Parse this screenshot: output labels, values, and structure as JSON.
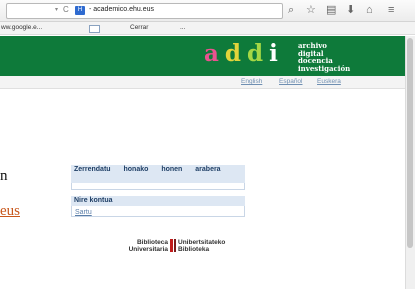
{
  "browser": {
    "dropdown_glyph": "▾",
    "reload_glyph": "C",
    "favicon_text": "H",
    "url_text": "- academico.ehu.eus",
    "icons": {
      "search": "⌕",
      "star": "☆",
      "bookmarks": "▤",
      "download": "⬇",
      "home": "⌂",
      "menu": "≡"
    }
  },
  "bookmarks_bar": {
    "item1": "ww.google.e...",
    "item2": "Cerrar",
    "item3": "..."
  },
  "header": {
    "logo_letters": [
      "a",
      "d",
      "d",
      "i"
    ],
    "logo_colors": [
      "#e9528f",
      "#e2d43b",
      "#a6d845",
      "#ffffff"
    ],
    "tagline": [
      "archivo",
      "digital",
      "docencia",
      "investigación"
    ],
    "background_color": "#0e7a3a"
  },
  "languages": [
    "English",
    "Español",
    "Euskera"
  ],
  "left_content": {
    "fragment_1": "n",
    "fragment_2": "eus"
  },
  "sidebar": {
    "box1_title": "Zerrendatu honako honen arabera",
    "box2_title": "Nire kontua",
    "box2_link": "Sartu"
  },
  "footer_logo": {
    "left_line1": "Biblioteca",
    "left_line2": "Universitaria",
    "right_line1": "Unibertsitateko",
    "right_line2": "Biblioteka"
  }
}
